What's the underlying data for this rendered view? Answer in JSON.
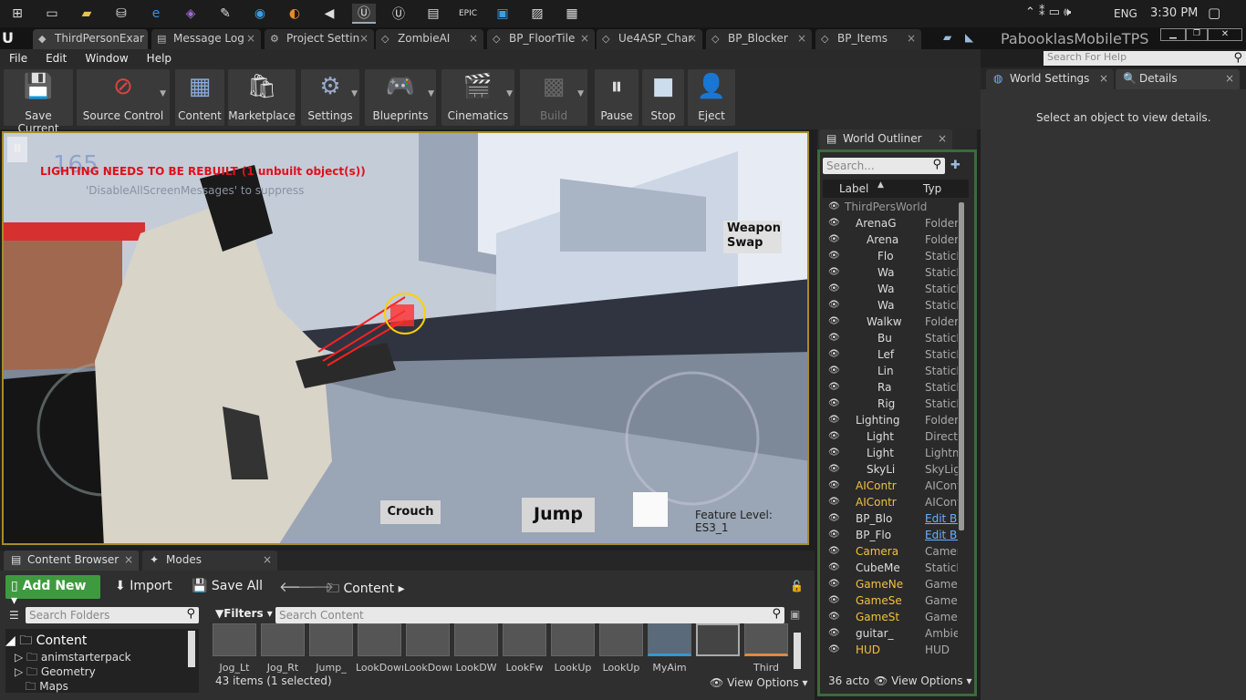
{
  "taskbar": {
    "time": "3:30 PM",
    "lang": "ENG"
  },
  "tabs": [
    {
      "label": "ThirdPersonExar",
      "icon": "ue-icon"
    },
    {
      "label": "Message Log",
      "icon": "log-icon"
    },
    {
      "label": "Project Settin",
      "icon": "settings-icon"
    },
    {
      "label": "ZombieAI",
      "icon": "ai-icon"
    },
    {
      "label": "BP_FloorTile",
      "icon": "blueprint-icon"
    },
    {
      "label": "Ue4ASP_Char",
      "icon": "blueprint-icon"
    },
    {
      "label": "BP_Blocker",
      "icon": "blueprint-icon"
    },
    {
      "label": "BP_Items",
      "icon": "blueprint-icon"
    }
  ],
  "project_name": "PabooklasMobileTPS",
  "menu": [
    "File",
    "Edit",
    "Window",
    "Help"
  ],
  "help_search_placeholder": "Search For Help",
  "toolbar": {
    "save": "Save Current",
    "source": "Source Control",
    "content": "Content",
    "marketplace": "Marketplace",
    "settings": "Settings",
    "blueprints": "Blueprints",
    "cinematics": "Cinematics",
    "build": "Build",
    "pause": "Pause",
    "stop": "Stop",
    "eject": "Eject"
  },
  "viewport": {
    "fps": "165",
    "warning": "LIGHTING NEEDS TO BE REBUILT (1 unbuilt object(s))",
    "sub": "'DisableAllScreenMessages' to suppress",
    "weapon_swap": "Weapon\nSwap",
    "crouch": "Crouch",
    "jump": "Jump",
    "feature_level": "Feature Level:  ES3_1"
  },
  "world_settings": {
    "tab": "World Settings",
    "details_tab": "Details",
    "empty": "Select an object to view details."
  },
  "outliner": {
    "tab": "World Outliner",
    "search_placeholder": "Search...",
    "col_label": "Label",
    "col_type": "Typ",
    "rows": [
      {
        "name": "ThirdPersWorld",
        "type": "",
        "indent": 0,
        "muted": true
      },
      {
        "name": "ArenaG",
        "type": "Folder",
        "indent": 1
      },
      {
        "name": "Arena",
        "type": "Folder",
        "indent": 2
      },
      {
        "name": "Flo",
        "type": "StaticM",
        "indent": 3
      },
      {
        "name": "Wa",
        "type": "StaticM",
        "indent": 3
      },
      {
        "name": "Wa",
        "type": "StaticM",
        "indent": 3
      },
      {
        "name": "Wa",
        "type": "StaticM",
        "indent": 3
      },
      {
        "name": "Walkw",
        "type": "Folder",
        "indent": 2
      },
      {
        "name": "Bu",
        "type": "StaticM",
        "indent": 3
      },
      {
        "name": "Lef",
        "type": "StaticM",
        "indent": 3
      },
      {
        "name": "Lin",
        "type": "StaticM",
        "indent": 3
      },
      {
        "name": "Ra",
        "type": "StaticM",
        "indent": 3
      },
      {
        "name": "Rig",
        "type": "StaticM",
        "indent": 3
      },
      {
        "name": "Lighting",
        "type": "Folder",
        "indent": 1
      },
      {
        "name": "Light",
        "type": "Directio",
        "indent": 2
      },
      {
        "name": "Light",
        "type": "Lightm",
        "indent": 2
      },
      {
        "name": "SkyLi",
        "type": "SkyLig",
        "indent": 2
      },
      {
        "name": "AIContr",
        "type": "AICont",
        "indent": 1,
        "gold": true
      },
      {
        "name": "AIContr",
        "type": "AICont",
        "indent": 1,
        "gold": true
      },
      {
        "name": "BP_Blo",
        "type": "Edit BI",
        "indent": 1,
        "link": true
      },
      {
        "name": "BP_Flo",
        "type": "Edit BI",
        "indent": 1,
        "link": true
      },
      {
        "name": "Camera",
        "type": "Camera",
        "indent": 1,
        "gold": true
      },
      {
        "name": "CubeMe",
        "type": "StaticM",
        "indent": 1
      },
      {
        "name": "GameNe",
        "type": "GameN",
        "indent": 1,
        "gold": true
      },
      {
        "name": "GameSe",
        "type": "GameS",
        "indent": 1,
        "gold": true
      },
      {
        "name": "GameSt",
        "type": "GameS",
        "indent": 1,
        "gold": true
      },
      {
        "name": "guitar_",
        "type": "Ambien",
        "indent": 1
      },
      {
        "name": "HUD",
        "type": "HUD",
        "indent": 1,
        "gold": true
      }
    ],
    "count": "36 acto",
    "view_options": "View Options"
  },
  "content_browser": {
    "tab": "Content Browser",
    "modes_tab": "Modes",
    "add_new": "Add New",
    "import": "Import",
    "save_all": "Save All",
    "path": "Content",
    "folder_search": "Search Folders",
    "filters": "Filters",
    "content_search": "Search Content",
    "tree": [
      {
        "name": "Content"
      },
      {
        "name": "animstarterpack"
      },
      {
        "name": "Geometry"
      },
      {
        "name": "Maps"
      }
    ],
    "assets": [
      "Jog_Lt",
      "Jog_Rt",
      "Jump_",
      "LookDown",
      "LookDown",
      "LookDW",
      "LookFw",
      "LookUp",
      "LookUp",
      "MyAim",
      "",
      "Third"
    ],
    "count": "43 items (1 selected)",
    "view_options": "View Options"
  }
}
